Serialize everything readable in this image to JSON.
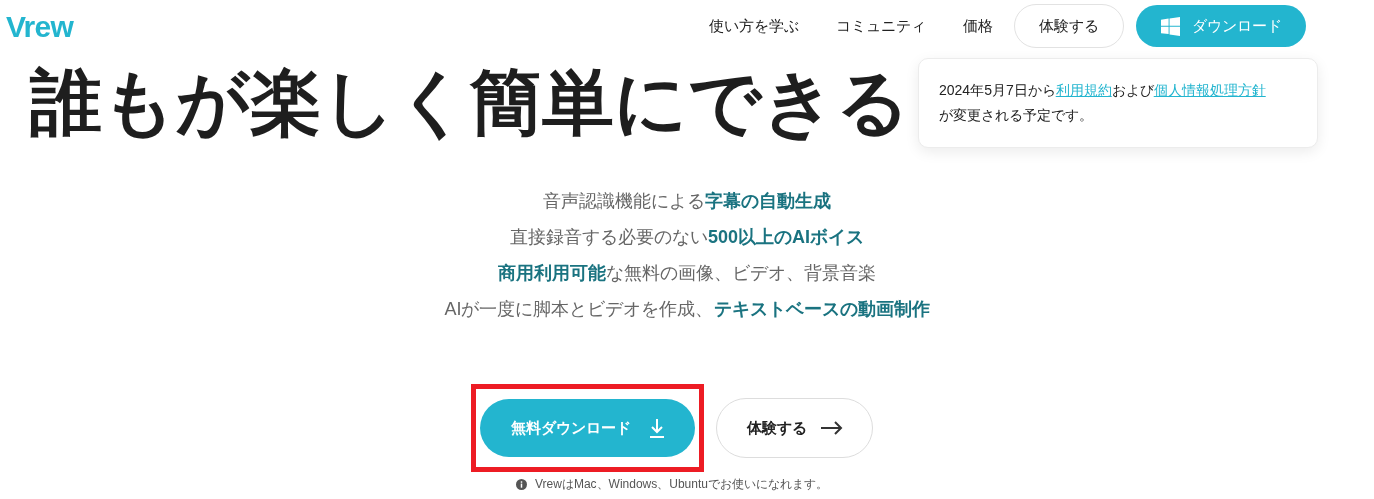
{
  "header": {
    "logo": "Vrew",
    "nav": [
      "使い方を学ぶ",
      "コミュニティ",
      "価格"
    ],
    "try_button": "体験する",
    "download_button": "ダウンロード"
  },
  "notice": {
    "before": "2024年5月7日から",
    "link_1": "利用規約",
    "middle": "および",
    "link_2": "個人情報処理方針",
    "after": "が変更される予定です。"
  },
  "hero": {
    "headline": "誰もが楽しく簡単にできる",
    "features": [
      "音声認識機能による**字幕の自動生成**",
      "直接録音する必要のない**500以上のAIボイス**",
      "**商用利用可能**な無料の画像、ビデオ、背景音楽",
      "AIが一度に脚本とビデオを作成、**テキストベースの動画制作**"
    ],
    "download_button": "無料ダウンロード",
    "download_highlighted": true,
    "try_button": "体験する",
    "note": "VrewはMac、Windows、Ubuntuでお使いになれます。"
  }
}
